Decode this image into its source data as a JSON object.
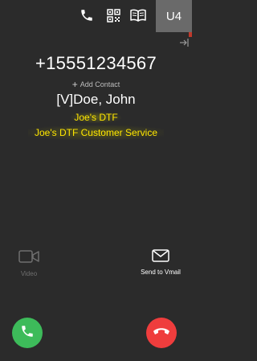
{
  "header": {
    "user_badge": "U4",
    "icons": [
      "phone-icon",
      "qr-code-icon",
      "book-icon"
    ]
  },
  "caller": {
    "number": "+15551234567",
    "add_contact_label": "Add Contact",
    "name": "[V]Doe, John",
    "company": "Joe's DTF",
    "queue": "Joe's DTF Customer Service"
  },
  "actions": {
    "video_label": "Video",
    "vmail_label": "Send to Vmail"
  },
  "colors": {
    "background": "#2b2b2b",
    "highlight_text": "#ffe600",
    "answer": "#3dbb5a",
    "hangup": "#ef3d3d",
    "badge": "#6a6a6a"
  }
}
